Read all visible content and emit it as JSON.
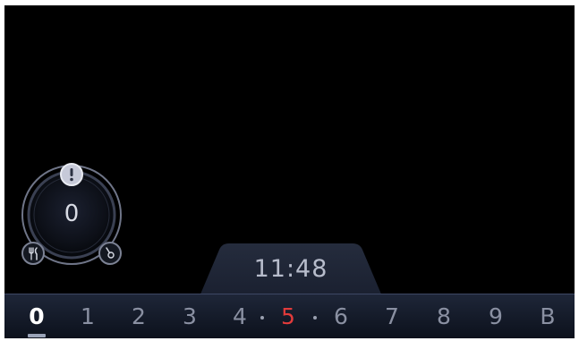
{
  "zone": {
    "level": "0"
  },
  "clock": {
    "time": "11:48"
  },
  "power_levels": {
    "items": [
      "0",
      "1",
      "2",
      "3",
      "4",
      "5",
      "6",
      "7",
      "8",
      "9",
      "B"
    ],
    "selected": "0",
    "active": "5"
  },
  "colors": {
    "background": "#000000",
    "bar_top": "#1e2638",
    "active_level": "#e23b3b",
    "text_dim": "#8a90a2"
  },
  "icons": {
    "warning": "exclamation-icon",
    "cook": "fork-knife-icon",
    "timer": "timer-icon"
  }
}
